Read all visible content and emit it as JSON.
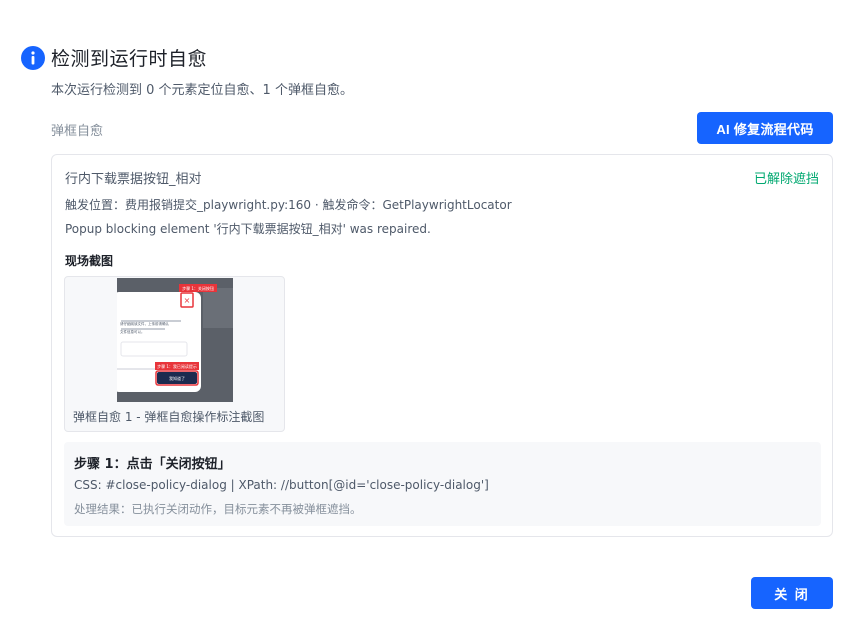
{
  "header": {
    "title": "检测到运行时自愈",
    "subtitle": "本次运行检测到 0 个元素定位自愈、1 个弹框自愈。"
  },
  "section": {
    "label": "弹框自愈",
    "ai_button_label": "AI 修复流程代码"
  },
  "card": {
    "title": "行内下载票据按钮_相对",
    "status": "已解除遮挡",
    "meta": "触发位置：费用报销提交_playwright.py:160 · 触发命令：GetPlaywrightLocator",
    "message": "Popup blocking element '行内下载票据按钮_相对' was repaired.",
    "screenshot_label": "现场截图",
    "screenshot": {
      "caption": "弹框自愈 1 - 弹框自愈操作标注截图",
      "tag_top": "步骤 1：关闭按钮",
      "tag_bottom": "步骤 1：我已阅读提示",
      "dialog_line1": "请仔细阅读文件，上传前请确认",
      "dialog_line2": "文件信息可以。",
      "confirm_label": "我知道了",
      "close_glyph": "×"
    },
    "step": {
      "title": "步骤 1：点击「关闭按钮」",
      "css": "CSS: #close-policy-dialog | XPath: //button[@id='close-policy-dialog']",
      "result": "处理结果：已执行关闭动作，目标元素不再被弹框遮挡。"
    }
  },
  "footer": {
    "close_label": "关 闭"
  },
  "colors": {
    "accent": "#1664ff",
    "success": "#00a870",
    "annotation": "#e8343a"
  }
}
